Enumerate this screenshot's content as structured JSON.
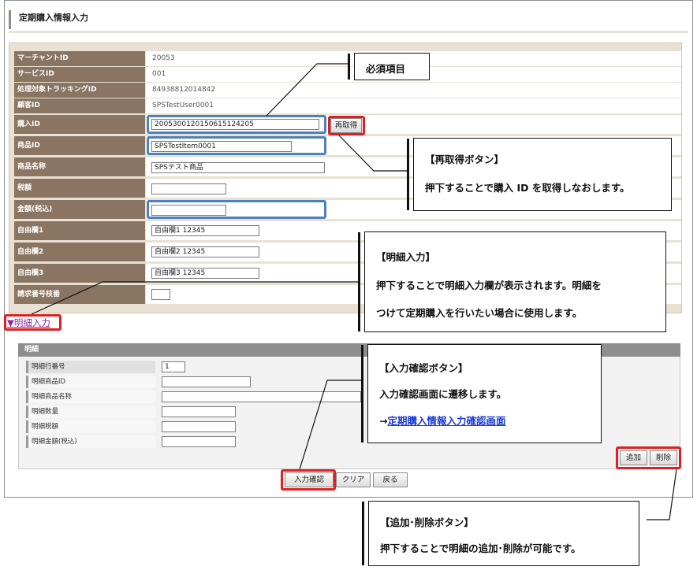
{
  "page_title": "定期購入情報入力",
  "form": {
    "rows": [
      {
        "label": "マーチャントID",
        "value": "20053"
      },
      {
        "label": "サービスID",
        "value": "001"
      },
      {
        "label": "処理対象トラッキングID",
        "value": "84938812014842"
      },
      {
        "label": "顧客ID",
        "value": "SPSTestUser0001"
      },
      {
        "label": "購入ID",
        "value": "20053001201506151242​05"
      },
      {
        "label": "商品ID",
        "value": "SPSTestItem0001"
      },
      {
        "label": "商品名称",
        "value": "SPSテスト商品"
      },
      {
        "label": "税額",
        "value": ""
      },
      {
        "label": "金額(税込)",
        "value": ""
      },
      {
        "label": "自由欄1",
        "value": "自由欄1 12345"
      },
      {
        "label": "自由欄2",
        "value": "自由欄2 12345"
      },
      {
        "label": "自由欄3",
        "value": "自由欄3 12345"
      },
      {
        "label": "請求番号枝番",
        "value": ""
      }
    ],
    "reacquire_label": "再取得"
  },
  "detail_toggle": "▼明細入力",
  "detail": {
    "header": "明細",
    "rows": [
      {
        "label": "明細行番号",
        "value": "1"
      },
      {
        "label": "明細商品ID",
        "value": ""
      },
      {
        "label": "明細商品名称",
        "value": ""
      },
      {
        "label": "明細数量",
        "value": ""
      },
      {
        "label": "明細税額",
        "value": ""
      },
      {
        "label": "明細金額(税込)",
        "value": ""
      }
    ],
    "add_label": "追加",
    "delete_label": "削除"
  },
  "actions": {
    "confirm": "入力確認",
    "clear": "クリア",
    "back": "戻る"
  },
  "callouts": {
    "required": "必須項目",
    "reacquire_title": "【再取得ボタン】",
    "reacquire_desc": "押下することで購入 ID を取得しなおします。",
    "detail_title": "【明細入力】",
    "detail_desc1": "押下することで明細入力欄が表示されます。明細を",
    "detail_desc2": "つけて定期購入を行いたい場合に使用します。",
    "confirm_title": "【入力確認ボタン】",
    "confirm_desc": "入力確認画面に遷移します。",
    "confirm_link_arrow": "→",
    "confirm_link": "定期購入情報入力確認画面",
    "adddel_title": "【追加･削除ボタン】",
    "adddel_desc": "押下することで明細の追加･削除が可能です。"
  },
  "colors": {
    "label_bg": "#8a7462",
    "highlight_blue": "#4d81bd",
    "highlight_red": "#e02020",
    "link": "#1a3bd6"
  }
}
